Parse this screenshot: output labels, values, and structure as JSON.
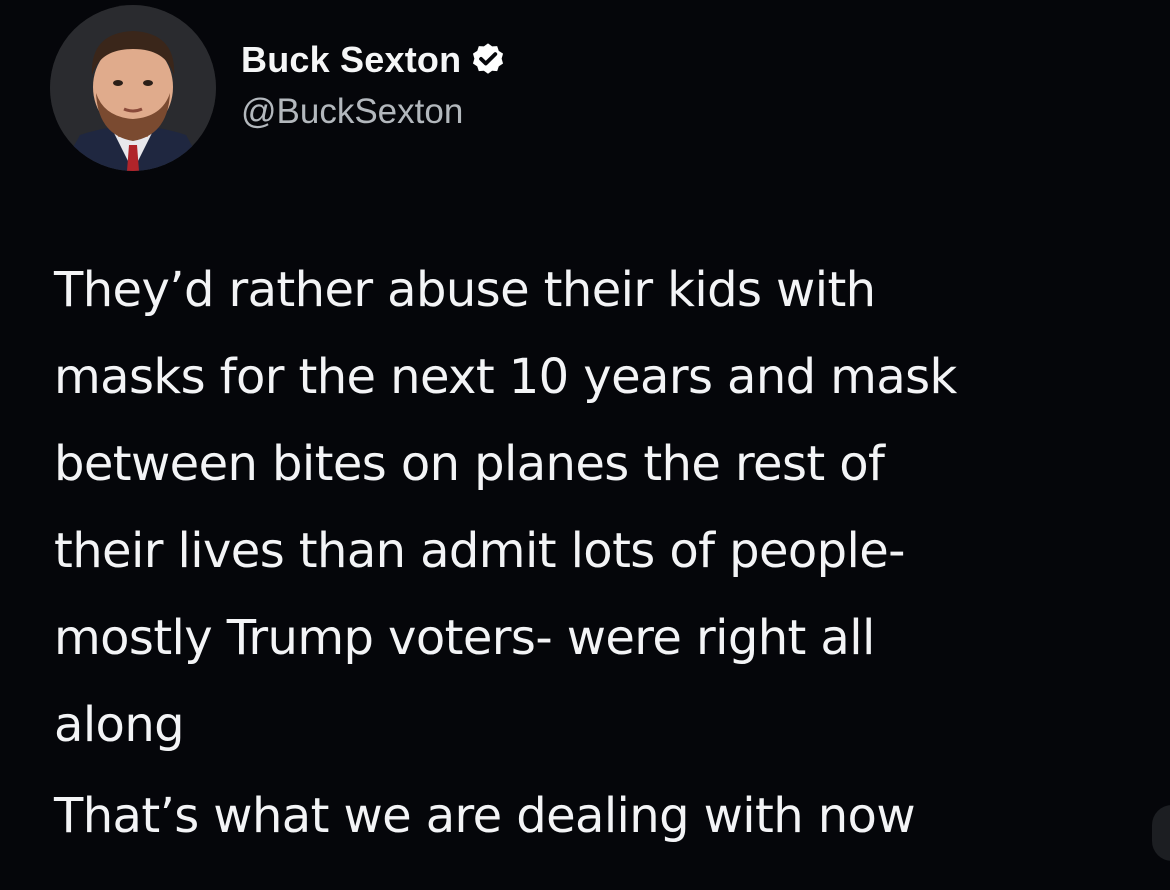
{
  "tweet": {
    "author": {
      "display_name": "Buck Sexton",
      "handle": "@BuckSexton",
      "verified": true,
      "avatar_icon": "profile-photo-man-in-suit"
    },
    "paragraphs": [
      "They’d rather abuse their kids with\nmasks for the next 10 years and mask\nbetween bites on planes the rest of\ntheir lives than admit lots of people-\nmostly Trump voters- were right all\nalong",
      "That’s what we are dealing with now"
    ]
  },
  "colors": {
    "background": "#05060a",
    "text": "#f3f4f6",
    "handle": "#b3b8bd",
    "verified_badge": "#ffffff"
  }
}
